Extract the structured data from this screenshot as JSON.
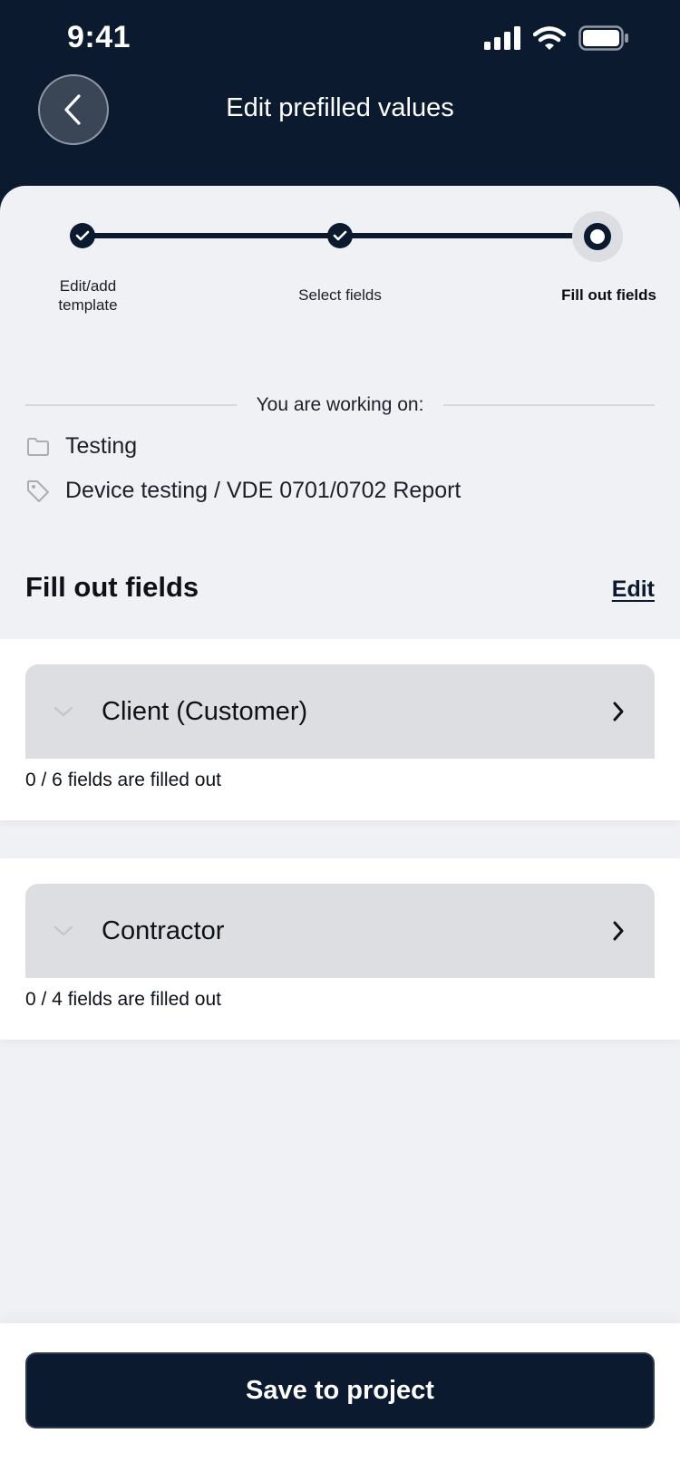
{
  "status_bar": {
    "time": "9:41"
  },
  "header": {
    "title": "Edit prefilled values",
    "back_icon": "chevron-left-icon"
  },
  "stepper": {
    "steps": [
      {
        "label": "Edit/add template",
        "state": "done"
      },
      {
        "label": "Select fields",
        "state": "done"
      },
      {
        "label": "Fill out fields",
        "state": "current"
      }
    ]
  },
  "context": {
    "heading": "You are working on:",
    "project": "Testing",
    "template": "Device testing / VDE 0701/0702 Report"
  },
  "section": {
    "title": "Fill out fields",
    "edit_label": "Edit"
  },
  "groups": [
    {
      "title": "Client (Customer)",
      "progress": "0 / 6 fields are filled out"
    },
    {
      "title": "Contractor",
      "progress": "0 / 4 fields are filled out"
    }
  ],
  "footer": {
    "save_label": "Save to project"
  },
  "colors": {
    "navy": "#0b1a2e",
    "sheet_bg": "#f0f1f5",
    "card_head": "#dcdee2"
  }
}
